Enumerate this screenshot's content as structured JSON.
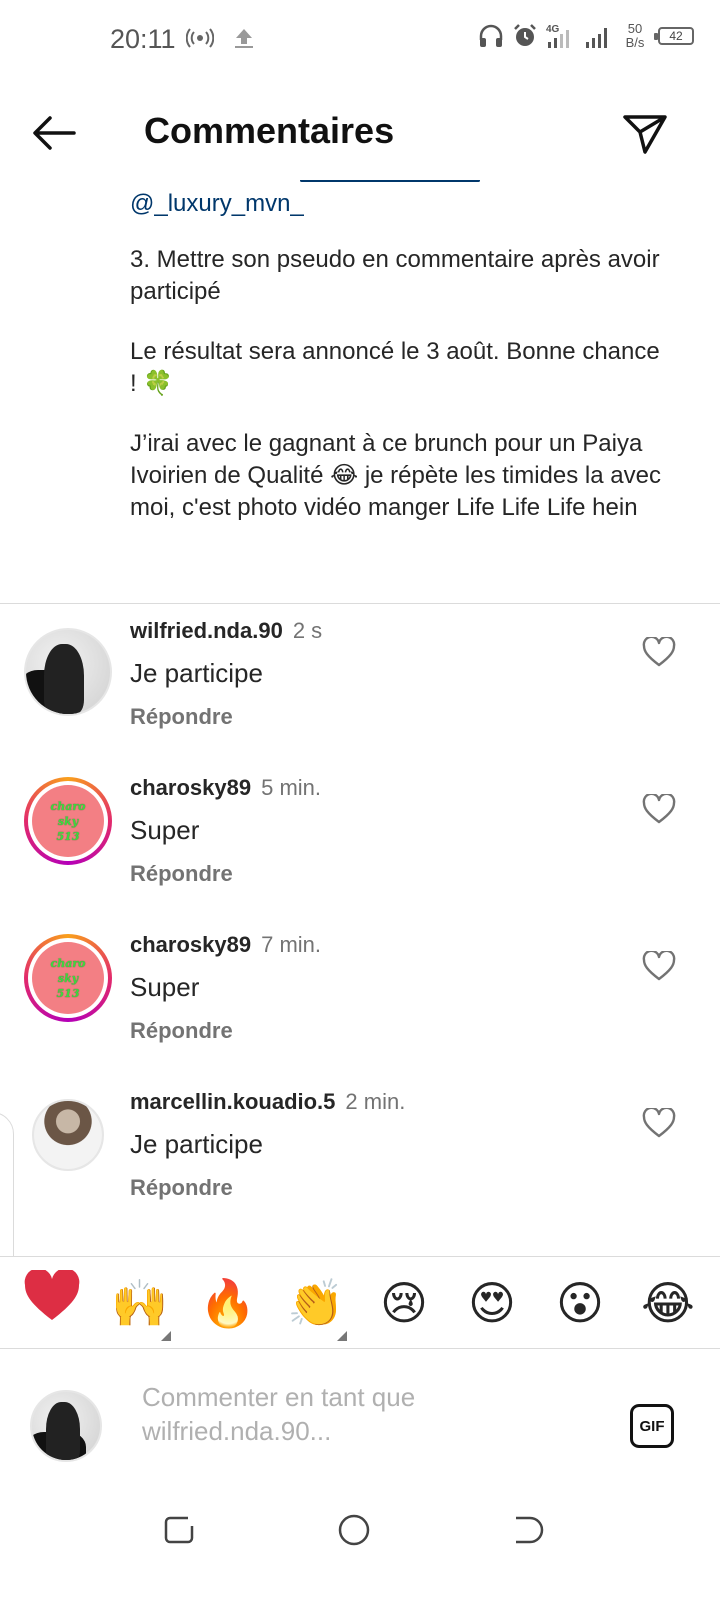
{
  "status_bar": {
    "time": "20:11",
    "net_speed_value": "50",
    "net_speed_unit": "B/s",
    "battery": "42",
    "icons": [
      "hotspot-icon",
      "upload-icon",
      "headphones-icon",
      "alarm-icon",
      "signal-4g-icon",
      "signal-icon",
      "battery-icon"
    ]
  },
  "header": {
    "title": "Commentaires"
  },
  "caption": {
    "mention": "@_luxury_mvn_",
    "paragraphs": [
      "3. Mettre son pseudo en commentaire après avoir participé",
      "Le résultat sera annoncé le 3 août. Bonne chance ! 🍀",
      "J’irai avec le gagnant à ce brunch  pour un Paiya Ivoirien de Qualité 😂 je répète les timides la avec moi, c'est photo vidéo manger Life Life Life hein"
    ]
  },
  "comments": [
    {
      "username": "wilfried.nda.90",
      "time": "2 s",
      "text": "Je participe",
      "reply": "Répondre"
    },
    {
      "username": "charosky89",
      "time": "5 min.",
      "text": "Super",
      "reply": "Répondre",
      "avatar_text": [
        "charo",
        "sky",
        "513"
      ]
    },
    {
      "username": "charosky89",
      "time": "7 min.",
      "text": "Super",
      "reply": "Répondre",
      "avatar_text": [
        "charo",
        "sky",
        "513"
      ]
    },
    {
      "username": "marcellin.kouadio.5",
      "time": "2 min.",
      "text": "Je participe",
      "reply": "Répondre"
    }
  ],
  "emoji_bar": {
    "items": [
      "❤️",
      "🙌",
      "🔥",
      "👏",
      "😢",
      "😍",
      "😮",
      "😂"
    ]
  },
  "composer": {
    "placeholder": "Commenter en tant que wilfried.nda.90...",
    "gif_label": "GIF"
  },
  "colors": {
    "mention": "#00376b",
    "text": "#262626",
    "secondary": "#737373"
  }
}
